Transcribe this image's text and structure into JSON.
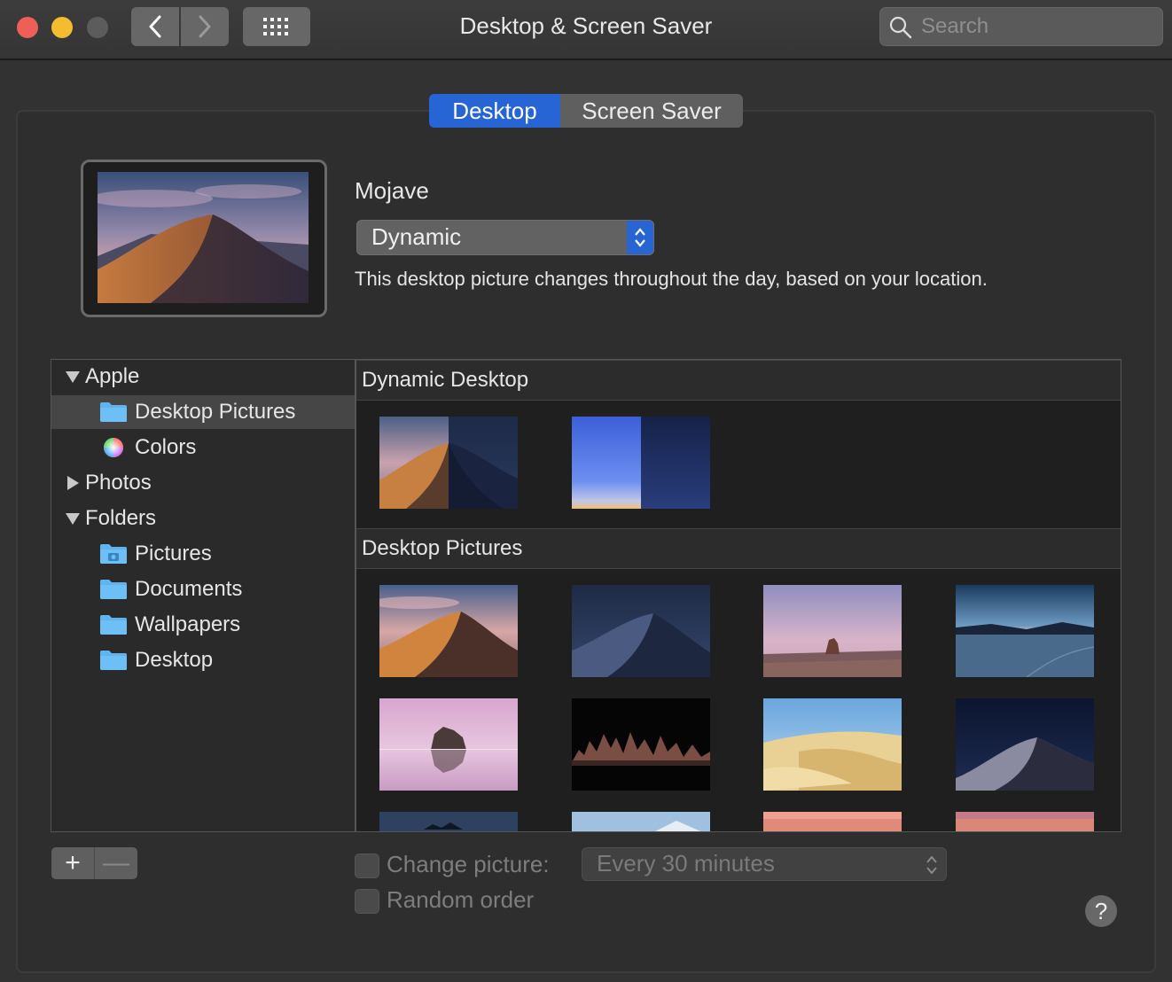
{
  "window": {
    "title": "Desktop & Screen Saver"
  },
  "toolbar": {
    "search_placeholder": "Search"
  },
  "tabs": [
    {
      "label": "Desktop",
      "selected": true
    },
    {
      "label": "Screen Saver",
      "selected": false
    }
  ],
  "current": {
    "name": "Mojave",
    "mode": "Dynamic",
    "description": "This desktop picture changes throughout the day, based on your location."
  },
  "sidebar": {
    "apple": "Apple",
    "desktop_pictures": "Desktop Pictures",
    "colors": "Colors",
    "photos": "Photos",
    "folders": "Folders",
    "pictures": "Pictures",
    "documents": "Documents",
    "wallpapers": "Wallpapers",
    "desktop": "Desktop"
  },
  "sections": {
    "dynamic": "Dynamic Desktop",
    "pictures": "Desktop Pictures"
  },
  "controls": {
    "add": "+",
    "remove": "—",
    "change_picture": "Change picture:",
    "interval": "Every 30 minutes",
    "random_order": "Random order",
    "help": "?"
  },
  "colors": {
    "accent": "#2765d5",
    "close": "#ed5f57",
    "minimize": "#f3bd2f",
    "folder": "#5fb4ef"
  }
}
